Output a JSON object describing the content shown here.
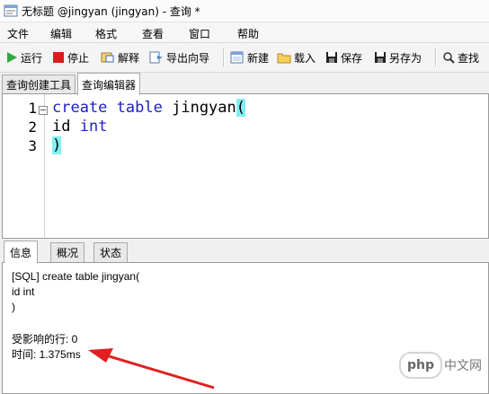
{
  "window": {
    "title": "无标题 @jingyan (jingyan) - 查询 *"
  },
  "menu": [
    "文件",
    "编辑",
    "格式",
    "查看",
    "窗口",
    "帮助"
  ],
  "toolbar": {
    "run": "运行",
    "stop": "停止",
    "explain": "解释",
    "export_wizard": "导出向导",
    "new": "新建",
    "load": "载入",
    "save": "保存",
    "save_as": "另存为",
    "find": "查找"
  },
  "tabs": [
    "查询创建工具",
    "查询编辑器"
  ],
  "editor": {
    "line_numbers": [
      "1",
      "2",
      "3"
    ],
    "lines": [
      {
        "kw1": "create",
        "kw2": "table",
        "ident": "jingyan",
        "paren": "("
      },
      {
        "ident": "id",
        "kw": "int"
      },
      {
        "paren": ")"
      }
    ]
  },
  "bottom_tabs": [
    "信息",
    "概况",
    "状态"
  ],
  "messages": [
    "[SQL] create table jingyan(",
    "id int",
    ")",
    "",
    "受影响的行: 0",
    "时间: 1.375ms"
  ],
  "watermark": {
    "logo": "php",
    "text": "中文网"
  },
  "colors": {
    "keyword": "#2020c0",
    "bracket_highlight": "#80f0f0",
    "arrow": "#e02020"
  }
}
